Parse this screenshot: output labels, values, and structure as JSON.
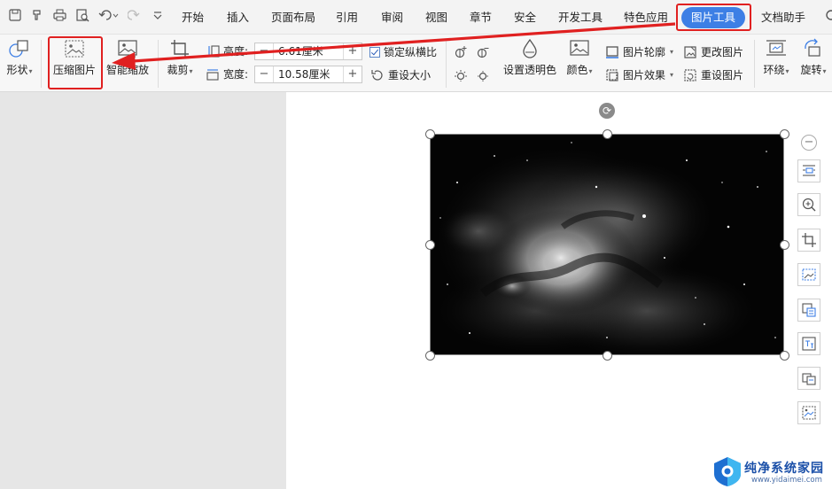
{
  "quick_access": {
    "icons": [
      "save-icon",
      "format-painter-icon",
      "print-icon",
      "print-preview-icon",
      "undo-icon",
      "redo-icon",
      "customize-icon"
    ]
  },
  "menu": {
    "tabs": [
      {
        "label": "开始"
      },
      {
        "label": "插入"
      },
      {
        "label": "页面布局"
      },
      {
        "label": "引用"
      },
      {
        "label": "审阅"
      },
      {
        "label": "视图"
      },
      {
        "label": "章节"
      },
      {
        "label": "安全"
      },
      {
        "label": "开发工具"
      },
      {
        "label": "特色应用"
      },
      {
        "label": "图片工具",
        "active": true
      },
      {
        "label": "文档助手"
      }
    ],
    "active_color": "#3d7fe5"
  },
  "ribbon": {
    "shape_label": "形状",
    "compress_label": "压缩图片",
    "smart_zoom_label": "智能缩放",
    "crop_label": "裁剪",
    "height_label": "高度:",
    "height_value": "6.61厘米",
    "width_label": "宽度:",
    "width_value": "10.58厘米",
    "lock_ratio_label": "锁定纵横比",
    "reset_size_label": "重设大小",
    "set_transparent_label": "设置透明色",
    "color_label": "颜色",
    "picture_outline_label": "图片轮廓",
    "picture_effect_label": "图片效果",
    "change_picture_label": "更改图片",
    "reset_picture_label": "重设图片",
    "wrap_label": "环绕",
    "rotate_label": "旋转",
    "minus": "−",
    "plus": "+"
  },
  "annotation": {
    "color": "#e02020"
  },
  "watermark": {
    "title": "纯净系统家园",
    "url": "www.yidaimei.com"
  }
}
